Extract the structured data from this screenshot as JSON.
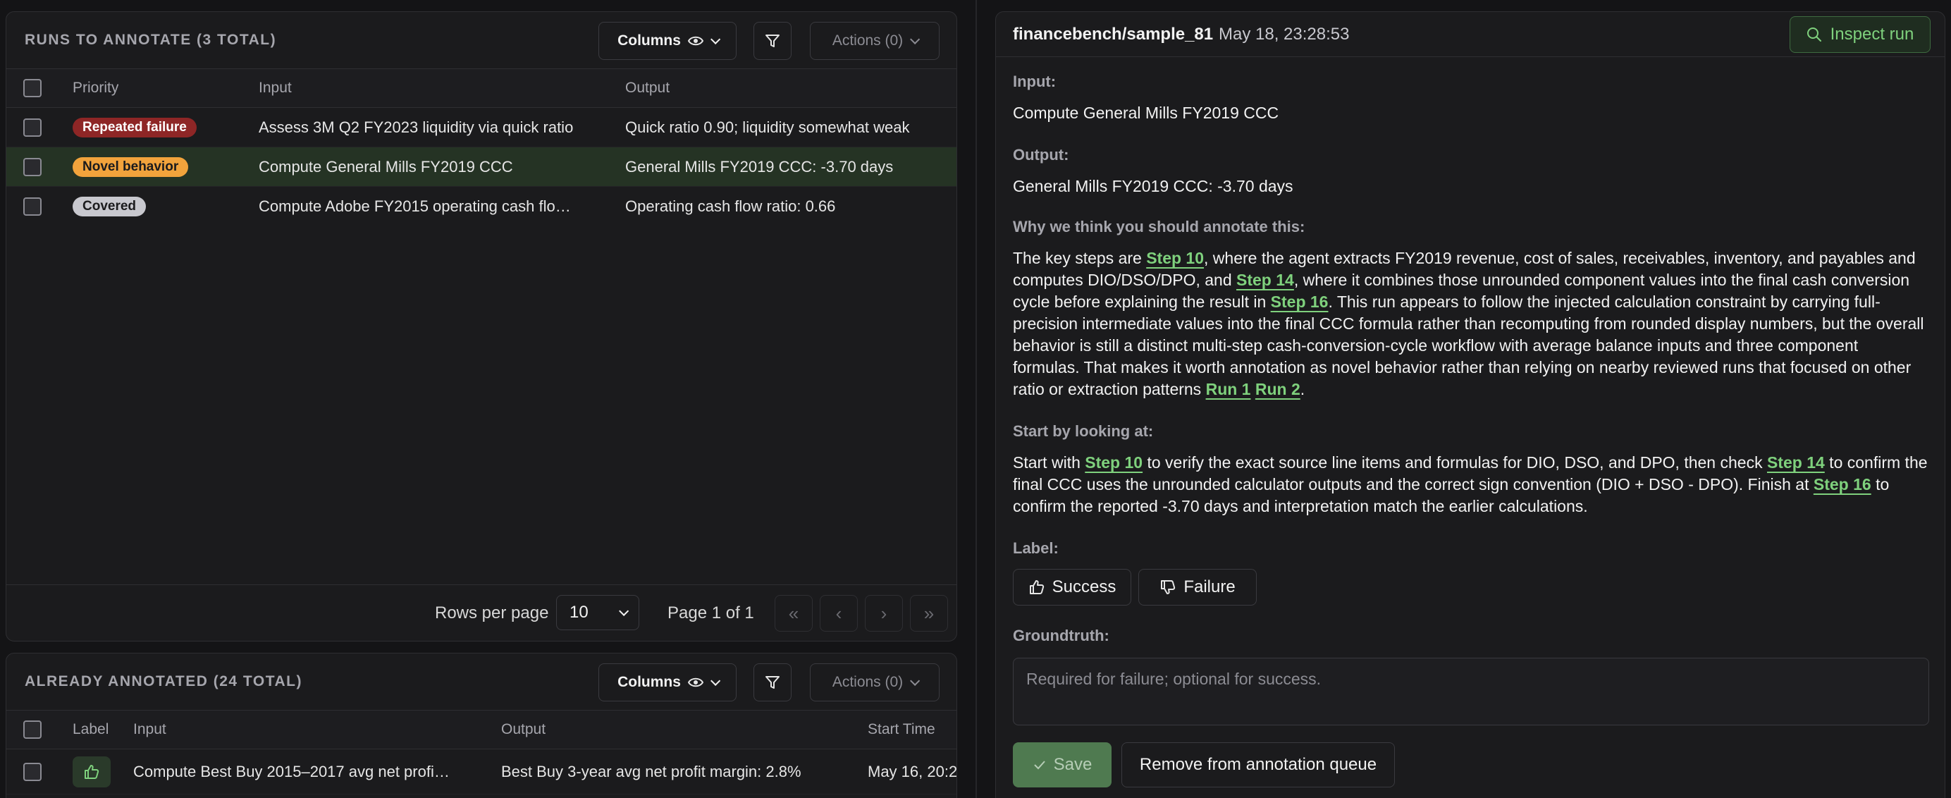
{
  "runs_panel": {
    "title": "RUNS TO ANNOTATE (3 TOTAL)",
    "columns_label": "Columns",
    "actions_label": "Actions (0)",
    "headers": {
      "priority": "Priority",
      "input": "Input",
      "output": "Output"
    },
    "rows": [
      {
        "priority": "Repeated failure",
        "input": "Assess 3M Q2 FY2023 liquidity via quick ratio",
        "output": "Quick ratio 0.90; liquidity somewhat weak"
      },
      {
        "priority": "Novel behavior",
        "input": "Compute General Mills FY2019 CCC",
        "output": "General Mills FY2019 CCC: -3.70 days"
      },
      {
        "priority": "Covered",
        "input": "Compute Adobe FY2015 operating cash flo…",
        "output": "Operating cash flow ratio: 0.66"
      }
    ],
    "pager": {
      "rows_per_page_label": "Rows per page",
      "rows_per_page_value": "10",
      "page_label": "Page 1 of 1"
    }
  },
  "annotated_panel": {
    "title": "ALREADY ANNOTATED (24 TOTAL)",
    "columns_label": "Columns",
    "actions_label": "Actions (0)",
    "headers": {
      "label": "Label",
      "input": "Input",
      "output": "Output",
      "start_time": "Start Time"
    },
    "rows": [
      {
        "input": "Compute Best Buy 2015–2017 avg net profi…",
        "output": "Best Buy 3-year avg net profit margin: 2.8%",
        "start_time": "May 16, 20:2"
      }
    ]
  },
  "detail": {
    "run_name": "financebench/sample_81",
    "timestamp": "May 18, 23:28:53",
    "inspect_label": "Inspect run",
    "input_label": "Input:",
    "input_value": "Compute General Mills FY2019 CCC",
    "output_label": "Output:",
    "output_value": "General Mills FY2019 CCC: -3.70 days",
    "why_label": "Why we think you should annotate this:",
    "why": {
      "p1": "The key steps are ",
      "l1": "Step 10",
      "p2": ", where the agent extracts FY2019 revenue, cost of sales, receivables, inventory, and payables and computes DIO/DSO/DPO, and ",
      "l2": "Step 14",
      "p3": ", where it combines those unrounded component values into the final cash conversion cycle before explaining the result in ",
      "l3": "Step 16",
      "p4": ". This run appears to follow the injected calculation constraint by carrying full-precision intermediate values into the final CCC formula rather than recomputing from rounded display numbers, but the overall behavior is still a distinct multi-step cash-conversion-cycle workflow with average balance inputs and three component formulas. That makes it worth annotation as novel behavior rather than relying on nearby reviewed runs that focused on other ratio or extraction patterns ",
      "l4": "Run 1",
      "l5": "Run 2",
      "p5": "."
    },
    "start_label": "Start by looking at:",
    "start": {
      "p1": "Start with ",
      "l1": "Step 10",
      "p2": " to verify the exact source line items and formulas for DIO, DSO, and DPO, then check ",
      "l2": "Step 14",
      "p3": " to confirm the final CCC uses the unrounded calculator outputs and the correct sign convention (DIO + DSO - DPO). Finish at ",
      "l3": "Step 16",
      "p4": " to confirm the reported -3.70 days and interpretation match the earlier calculations."
    },
    "label_label": "Label:",
    "success_label": "Success",
    "failure_label": "Failure",
    "groundtruth_label": "Groundtruth:",
    "groundtruth_placeholder": "Required for failure; optional for success.",
    "save_label": "Save",
    "remove_label": "Remove from annotation queue"
  },
  "colors": {
    "accent_green": "#7fd17d",
    "badge_repeated_failure": "#8e2626",
    "badge_novel_behavior": "#f2a33c",
    "badge_covered": "#c8c8ce",
    "selected_row": "#253324"
  },
  "icons": [
    "eye-icon",
    "chevron-down-icon",
    "filter-icon",
    "search-icon",
    "thumbs-up-icon",
    "thumbs-down-icon",
    "check-icon",
    "first-page-icon",
    "prev-page-icon",
    "next-page-icon",
    "last-page-icon"
  ]
}
